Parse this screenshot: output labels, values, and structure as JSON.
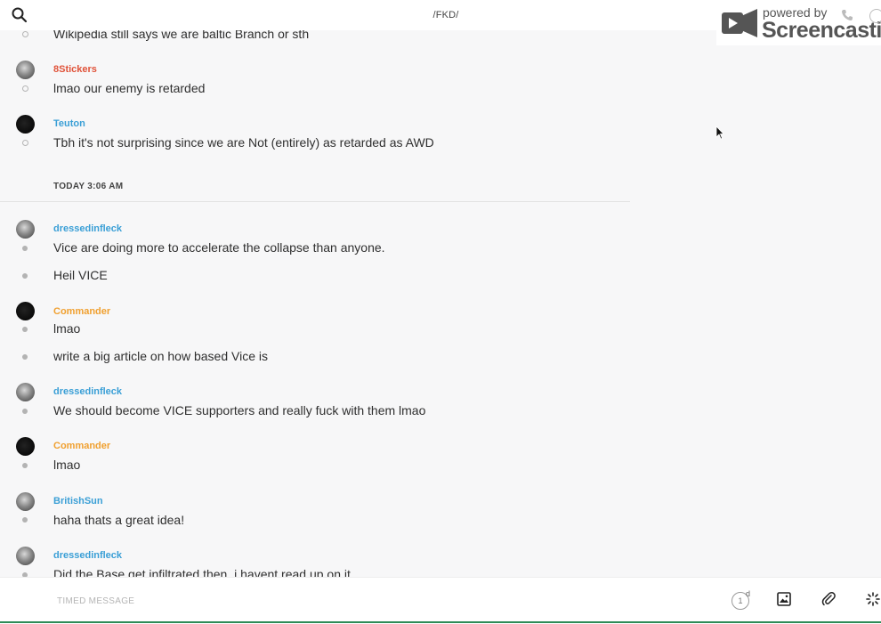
{
  "header": {
    "channel_title": "/FKD/",
    "search_icon": "search-icon"
  },
  "watermark": {
    "powered_by": "powered by",
    "brand": "Screencastify"
  },
  "chat": {
    "date_separator": "TODAY 3:06 AM",
    "messages": [
      {
        "author": "",
        "text": "Wikipedia still says we are baltic Branch or sth"
      },
      {
        "author": "8Stickers",
        "text": "lmao our enemy is retarded",
        "author_color": "#e0533a"
      },
      {
        "author": "Teuton",
        "text": "Tbh it's not surprising since we are Not (entirely) as retarded as AWD",
        "author_color": "#3a9fd6"
      },
      {
        "author": "dressedinfleck",
        "text": "Vice are doing more to accelerate the collapse than anyone.",
        "author_color": "#3a9fd6"
      },
      {
        "author": "",
        "text": "Heil VICE"
      },
      {
        "author": "Commander",
        "text": "lmao",
        "author_color": "#f0a030"
      },
      {
        "author": "",
        "text": "write a big article on how based Vice is"
      },
      {
        "author": "dressedinfleck",
        "text": "We should become VICE supporters and really fuck with them lmao",
        "author_color": "#3a9fd6"
      },
      {
        "author": "Commander",
        "text": "lmao",
        "author_color": "#f0a030"
      },
      {
        "author": "BritishSun",
        "text": "haha thats a great idea!",
        "author_color": "#3a9fd6"
      },
      {
        "author": "dressedinfleck",
        "text": "Did the Base get infiltrated then, i havent read up on it",
        "author_color": "#3a9fd6"
      }
    ]
  },
  "composer": {
    "placeholder": "TIMED MESSAGE",
    "timer_value": "1",
    "timer_unit": "d",
    "icons": [
      "timer-icon",
      "image-icon",
      "attachment-icon",
      "loading-icon"
    ]
  }
}
